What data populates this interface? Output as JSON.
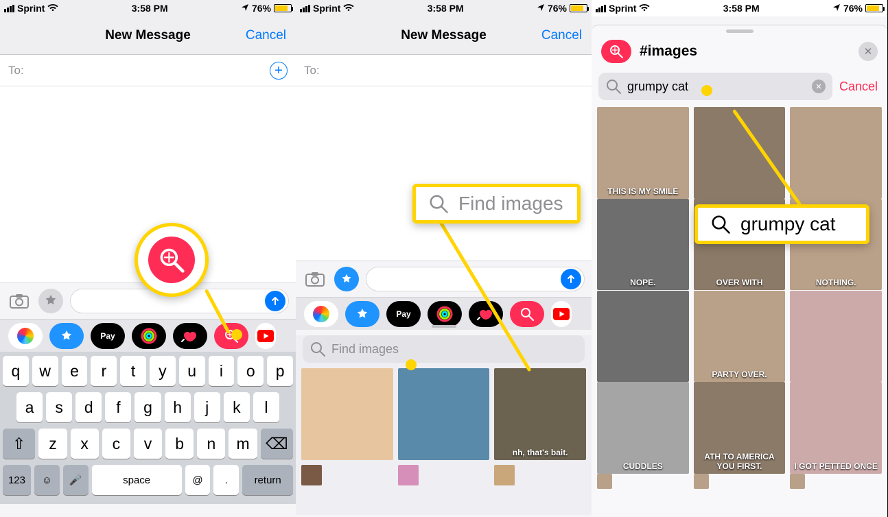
{
  "status": {
    "carrier": "Sprint",
    "time": "3:58 PM",
    "battery_pct": "76%",
    "location_icon": "▸"
  },
  "screen1": {
    "title": "New Message",
    "cancel": "Cancel",
    "to_label": "To:",
    "keyboard": {
      "row1": [
        "q",
        "w",
        "e",
        "r",
        "t",
        "y",
        "u",
        "i",
        "o",
        "p"
      ],
      "row2": [
        "a",
        "s",
        "d",
        "f",
        "g",
        "h",
        "j",
        "k",
        "l"
      ],
      "row3_shift": "⇧",
      "row3": [
        "z",
        "x",
        "c",
        "v",
        "b",
        "n",
        "m"
      ],
      "row3_bksp": "⌫",
      "bottom": {
        "num": "123",
        "emoji": "☺",
        "mic": "🎤",
        "space": "space",
        "at": "@",
        "dot": ".",
        "return": "return"
      }
    },
    "drawer_apps": [
      "photos",
      "appstore",
      "apay",
      "activity",
      "digitaltouch",
      "images",
      "youtube"
    ],
    "apay_label": "Pay"
  },
  "screen2": {
    "title": "New Message",
    "cancel": "Cancel",
    "to_label": "To:",
    "apay_label": "Pay",
    "find_placeholder": "Find images",
    "callout_text": "Find images",
    "trending_captions": [
      "",
      "",
      "nh, that's bait."
    ]
  },
  "screen3": {
    "sheet_title": "#images",
    "search_value": "grumpy cat",
    "cancel": "Cancel",
    "callout_text": "grumpy cat",
    "tile_captions": [
      "THIS IS MY SMILE",
      "",
      "",
      "NOPE.",
      "OVER WITH",
      "NOTHING.",
      "",
      "PARTY OVER.",
      "",
      "CUDDLES",
      "ATH TO AMERICA YOU FIRST.",
      "I GOT PETTED ONCE"
    ]
  }
}
